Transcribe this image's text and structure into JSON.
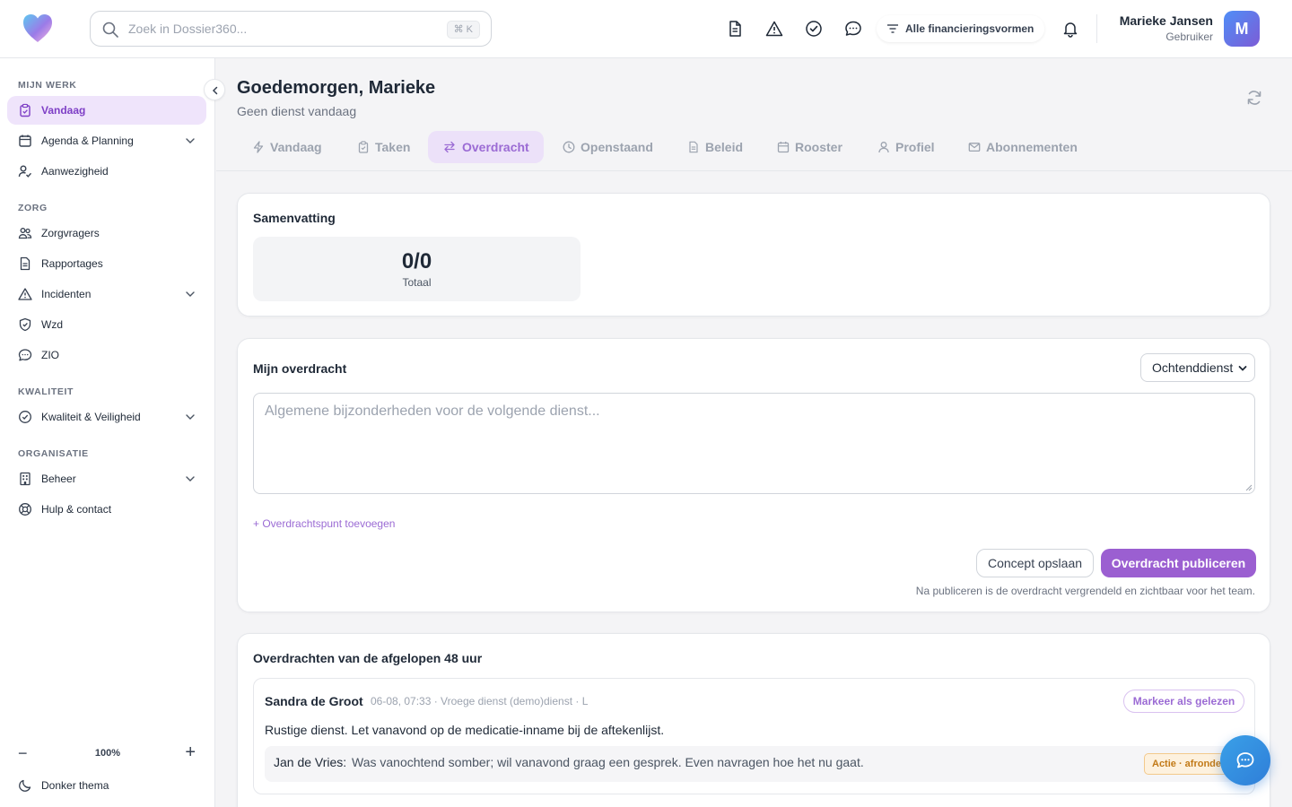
{
  "search": {
    "placeholder": "Zoek in Dossier360...",
    "shortcut": "⌘ K"
  },
  "header": {
    "icons": [
      "document-icon",
      "warning-icon",
      "check-circle-icon",
      "chat-icon",
      "bell-icon"
    ],
    "finance_filter": "Alle financieringsvormen",
    "user_name": "Marieke Jansen",
    "user_role": "Gebruiker",
    "avatar_initial": "M"
  },
  "sidebar": {
    "sections": [
      {
        "title": "MIJN WERK",
        "items": [
          {
            "label": "Vandaag",
            "icon": "clipboard-icon",
            "active": true
          },
          {
            "label": "Agenda & Planning",
            "icon": "calendar-icon",
            "expandable": true
          },
          {
            "label": "Aanwezigheid",
            "icon": "user-check-icon"
          }
        ]
      },
      {
        "title": "ZORG",
        "items": [
          {
            "label": "Zorgvragers",
            "icon": "users-icon"
          },
          {
            "label": "Rapportages",
            "icon": "document-icon"
          },
          {
            "label": "Incidenten",
            "icon": "warning-icon",
            "expandable": true
          },
          {
            "label": "Wzd",
            "icon": "shield-icon"
          },
          {
            "label": "ZIO",
            "icon": "chat-icon"
          }
        ]
      },
      {
        "title": "KWALITEIT",
        "items": [
          {
            "label": "Kwaliteit & Veiligheid",
            "icon": "check-circle-icon",
            "expandable": true
          }
        ]
      },
      {
        "title": "ORGANISATIE",
        "items": [
          {
            "label": "Beheer",
            "icon": "building-icon",
            "expandable": true
          },
          {
            "label": "Hulp & contact",
            "icon": "lifebuoy-icon"
          }
        ]
      }
    ],
    "zoom": "100%",
    "theme_toggle": "Donker thema"
  },
  "page": {
    "greeting": "Goedemorgen, Marieke",
    "subtitle": "Geen dienst vandaag"
  },
  "tabs": [
    {
      "label": "Vandaag",
      "icon": "bolt-icon"
    },
    {
      "label": "Taken",
      "icon": "clipboard-icon"
    },
    {
      "label": "Overdracht",
      "icon": "swap-icon",
      "active": true
    },
    {
      "label": "Openstaand",
      "icon": "clock-icon"
    },
    {
      "label": "Beleid",
      "icon": "document-icon"
    },
    {
      "label": "Rooster",
      "icon": "calendar-icon"
    },
    {
      "label": "Profiel",
      "icon": "user-icon"
    },
    {
      "label": "Abonnementen",
      "icon": "mail-icon"
    }
  ],
  "summary": {
    "title": "Samenvatting",
    "value": "0/0",
    "label": "Totaal"
  },
  "my_handover": {
    "title": "Mijn overdracht",
    "shift": "Ochtenddienst",
    "placeholder": "Algemene bijzonderheden voor de volgende dienst...",
    "add_point": "+ Overdrachtspunt toevoegen",
    "save_draft": "Concept opslaan",
    "publish": "Overdracht publiceren",
    "publish_note": "Na publiceren is de overdracht vergrendeld en zichtbaar voor het team."
  },
  "recent": {
    "title": "Overdrachten van de afgelopen 48 uur",
    "entries": [
      {
        "author": "Sandra de Groot",
        "meta": "06-08, 07:33 · Vroege dienst (demo)dienst · L",
        "mark_read": "Markeer als gelezen",
        "text": "Rustige dienst. Let vanavond op de medicatie-inname bij de aftekenlijst.",
        "points": [
          {
            "client": "Jan de Vries:",
            "text": "Was vanochtend somber; wil vanavond graag een gesprek. Even navragen hoe het nu gaat.",
            "badge": "Actie · afronden"
          }
        ]
      }
    ]
  }
}
